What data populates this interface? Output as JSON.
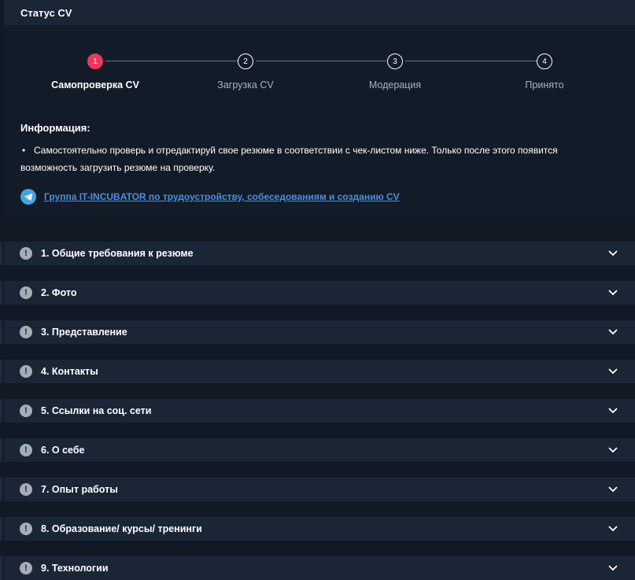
{
  "status": {
    "title": "Статус CV",
    "steps": [
      {
        "num": "1",
        "label": "Самопроверка CV",
        "active": true
      },
      {
        "num": "2",
        "label": "Загрузка CV",
        "active": false
      },
      {
        "num": "3",
        "label": "Модерация",
        "active": false
      },
      {
        "num": "4",
        "label": "Принято",
        "active": false
      }
    ]
  },
  "info": {
    "title": "Информация:",
    "bullet_line1": "Самостоятельно проверь и отредактируй свое резюме в соответствии с чек-листом ниже. Только после этого появится",
    "bullet_line2": "возможность загрузить резюме на проверку.",
    "link_text": "Группа IT-INCUBATOR по трудоустройству, собеседованиям и созданию CV",
    "link_icon": "telegram-icon"
  },
  "accordion": [
    {
      "title": "1. Общие требования к резюме"
    },
    {
      "title": "2. Фото"
    },
    {
      "title": "3. Представление"
    },
    {
      "title": "4. Контакты"
    },
    {
      "title": "5. Ссылки на соц. сети"
    },
    {
      "title": "6. О себе"
    },
    {
      "title": "7. Опыт работы"
    },
    {
      "title": "8. Образование/ курсы/ тренинги"
    },
    {
      "title": "9. Технологии"
    }
  ],
  "colors": {
    "active_step": "#e8395f",
    "link": "#4a8fe2",
    "panel": "#1a2535",
    "background": "#111924"
  }
}
